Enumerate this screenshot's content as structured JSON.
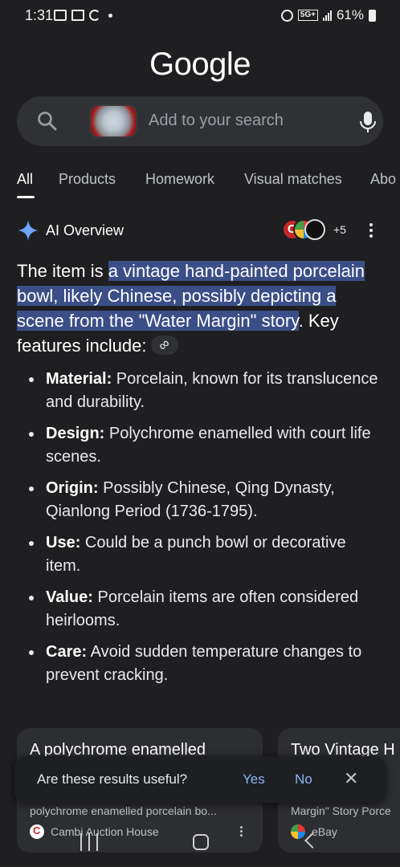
{
  "status_bar": {
    "time": "1:31",
    "network": "5G+",
    "battery": "61%"
  },
  "logo": "Google",
  "search": {
    "placeholder": "Add to your search",
    "thumb_icon": "bowl-image-thumbnail"
  },
  "tabs": [
    {
      "label": "All",
      "active": true
    },
    {
      "label": "Products"
    },
    {
      "label": "Homework"
    },
    {
      "label": "Visual matches"
    },
    {
      "label": "Abo"
    }
  ],
  "ai_overview": {
    "title": "AI Overview",
    "sources_more": "+5",
    "intro_before": "The item is ",
    "intro_highlight": "a vintage hand-painted porcelain bowl, likely Chinese, possibly depicting a scene from the \"Water Margin\" story",
    "intro_after": ". Key features include:",
    "bullets": [
      {
        "label": "Material:",
        "text": " Porcelain, known for its translucence and durability."
      },
      {
        "label": "Design:",
        "text": " Polychrome enamelled with court life scenes."
      },
      {
        "label": "Origin:",
        "text": " Possibly Chinese, Qing Dynasty, Qianlong Period (1736-1795)."
      },
      {
        "label": "Use:",
        "text": " Could be a punch bowl or decorative item."
      },
      {
        "label": "Value:",
        "text": " Porcelain items are often considered heirlooms."
      },
      {
        "label": "Care:",
        "text": " Avoid sudden temperature changes to prevent cracking."
      }
    ]
  },
  "cards": [
    {
      "title": "A polychrome enamelled",
      "desc": "polychrome enamelled porcelain bo...",
      "source": "Cambi Auction House"
    },
    {
      "title": "Two Vintage H",
      "desc": "Margin\" Story Porce",
      "source": "eBay"
    }
  ],
  "feedback": {
    "question": "Are these results useful?",
    "yes": "Yes",
    "no": "No",
    "close": "✕"
  },
  "colors": {
    "background": "#1f1f21",
    "highlight": "#3b4e87",
    "link": "#8ab4f8"
  }
}
